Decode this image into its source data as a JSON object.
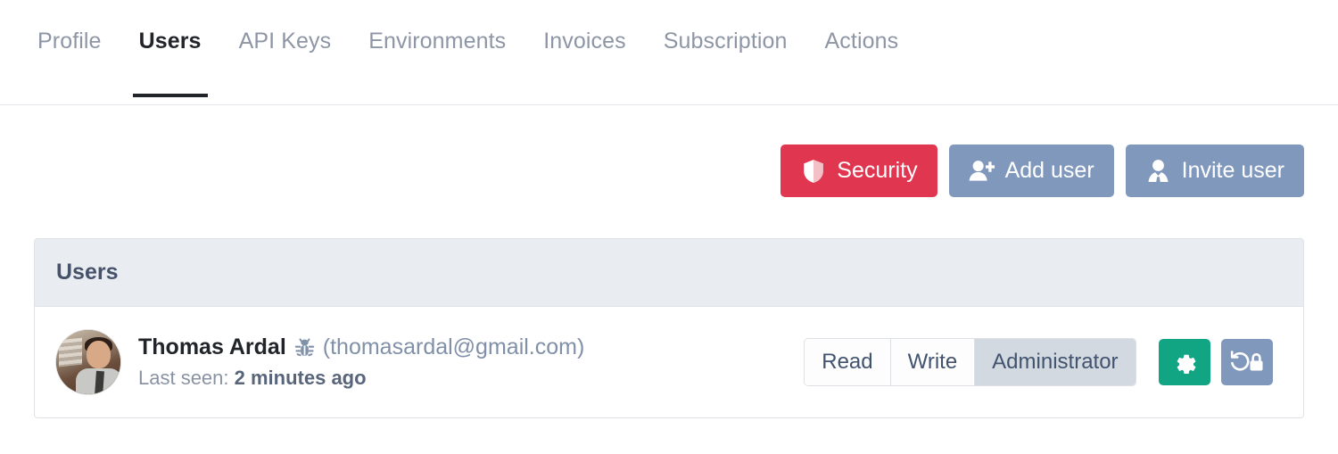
{
  "tabs": [
    {
      "label": "Profile",
      "active": false
    },
    {
      "label": "Users",
      "active": true
    },
    {
      "label": "API Keys",
      "active": false
    },
    {
      "label": "Environments",
      "active": false
    },
    {
      "label": "Invoices",
      "active": false
    },
    {
      "label": "Subscription",
      "active": false
    },
    {
      "label": "Actions",
      "active": false
    }
  ],
  "toolbar": {
    "security_label": "Security",
    "security_icon": "shield-icon",
    "add_user_label": "Add user",
    "add_user_icon": "user-plus-icon",
    "invite_user_label": "Invite user",
    "invite_user_icon": "user-tie-icon"
  },
  "card": {
    "title": "Users"
  },
  "user": {
    "name": "Thomas Ardal",
    "bug_icon": "bug-icon",
    "email": "(thomasardal@gmail.com)",
    "last_seen_label": "Last seen:",
    "last_seen_value": "2 minutes ago",
    "avatar_icon": "avatar-photo",
    "permissions": [
      {
        "label": "Read",
        "active": false
      },
      {
        "label": "Write",
        "active": false
      },
      {
        "label": "Administrator",
        "active": true
      }
    ],
    "settings_icon": "gear-icon",
    "reset_password_icon": "undo-lock-icon"
  },
  "colors": {
    "danger": "#e0364f",
    "slate": "#8198bd",
    "green": "#11a584",
    "active_tab": "#212529",
    "muted": "#8e96a6",
    "card_header_bg": "#e9edf1",
    "segment_active_bg": "#d3d9e0"
  }
}
